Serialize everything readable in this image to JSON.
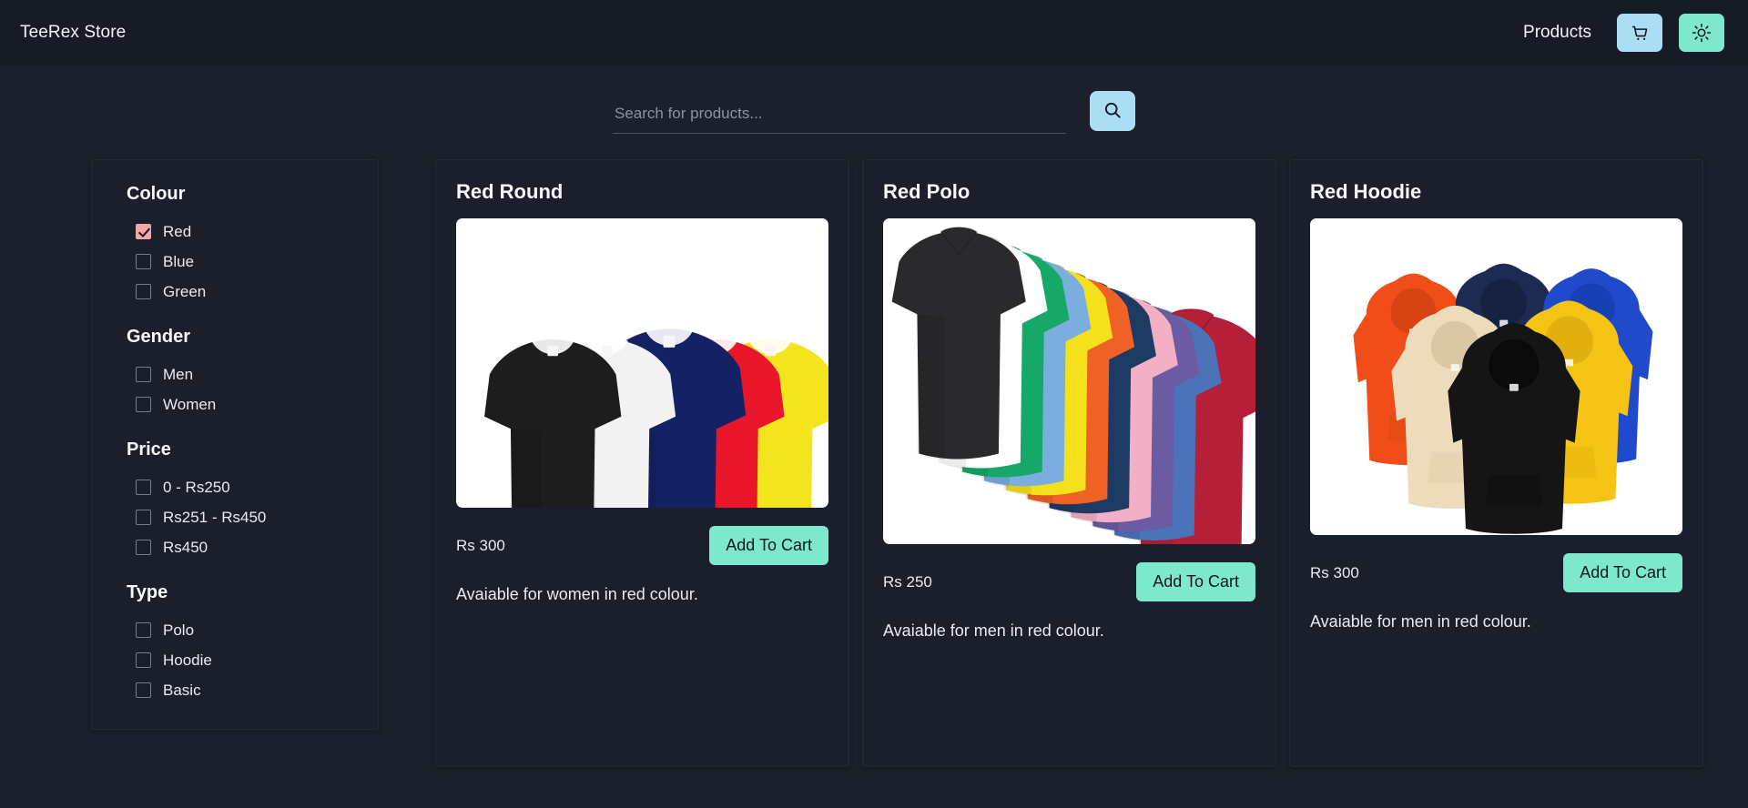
{
  "header": {
    "brand": "TeeRex Store",
    "nav_link": "Products",
    "cart_icon": "shopping-cart-icon",
    "theme_icon": "sun-icon",
    "cart_bg": "#abddf5",
    "theme_bg": "#7ee8cd"
  },
  "search": {
    "placeholder": "Search for products...",
    "value": "",
    "button_icon": "search-icon",
    "button_bg": "#abddf5"
  },
  "filters": [
    {
      "title": "Colour",
      "options": [
        {
          "label": "Red",
          "checked": true
        },
        {
          "label": "Blue",
          "checked": false
        },
        {
          "label": "Green",
          "checked": false
        }
      ]
    },
    {
      "title": "Gender",
      "options": [
        {
          "label": "Men",
          "checked": false
        },
        {
          "label": "Women",
          "checked": false
        }
      ]
    },
    {
      "title": "Price",
      "options": [
        {
          "label": "0 - Rs250",
          "checked": false
        },
        {
          "label": "Rs251 - Rs450",
          "checked": false
        },
        {
          "label": "Rs450",
          "checked": false
        }
      ]
    },
    {
      "title": "Type",
      "options": [
        {
          "label": "Polo",
          "checked": false
        },
        {
          "label": "Hoodie",
          "checked": false
        },
        {
          "label": "Basic",
          "checked": false
        }
      ]
    }
  ],
  "products": [
    {
      "name": "Red Round",
      "price": "Rs 300",
      "button": "Add To Cart",
      "description": "Avaiable for women in red colour.",
      "image": "round-neck-tshirts-photo",
      "image_colors": [
        "#1d1d1d",
        "#f2f2f2",
        "#152165",
        "#e8152b",
        "#f2e51e"
      ]
    },
    {
      "name": "Red Polo",
      "price": "Rs 250",
      "button": "Add To Cart",
      "description": "Avaiable for men in red colour.",
      "image": "polo-shirts-photo",
      "image_colors": [
        "#2a2a2c",
        "#ffffff",
        "#15a869",
        "#79aede",
        "#f5e01c",
        "#ef6124",
        "#1d3a63",
        "#f3afc6",
        "#6a5ba3",
        "#4c72b8",
        "#b61f38"
      ]
    },
    {
      "name": "Red Hoodie",
      "price": "Rs 300",
      "button": "Add To Cart",
      "description": "Avaiable for men in red colour.",
      "image": "hoodies-photo",
      "image_colors": [
        "#f04d18",
        "#1d2b52",
        "#2049cc",
        "#ecdcbc",
        "#151515",
        "#f5c313"
      ]
    }
  ],
  "theme": {
    "page_bg": "#1b202c",
    "navbar_bg": "#161b26",
    "card_bg": "#1a1f2b",
    "accent_mint": "#7ee8cd",
    "accent_blue": "#abddf5",
    "checked_pink": "#f6a6a6"
  }
}
